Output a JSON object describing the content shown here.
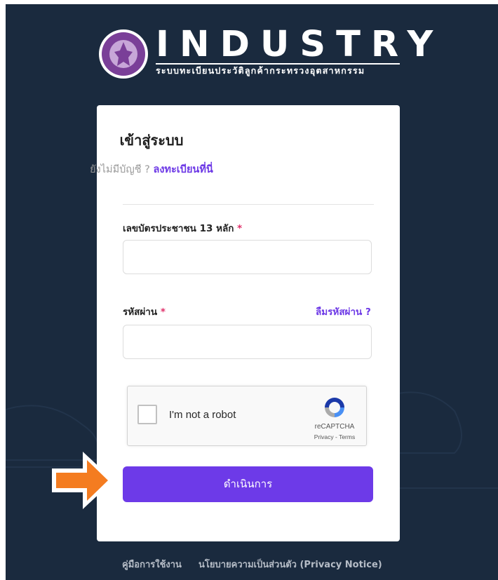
{
  "header": {
    "brand": "INDUSTRY",
    "subtitle": "ระบบทะเบียนประวัติลูกค้ากระทรวงอุตสาหกรรม",
    "seal_icon": "ministry-seal-icon"
  },
  "login": {
    "title": "เข้าสู่ระบบ",
    "signup_question": "ยังไม่มีบัญชี ?",
    "signup_link": "ลงทะเบียนที่นี่",
    "id_label": "เลขบัตรประชาชน 13 หลัก",
    "id_value": "",
    "password_label": "รหัสผ่าน",
    "password_value": "",
    "required_mark": "*",
    "forgot_password": "ลืมรหัสผ่าน ?",
    "submit_label": "ดำเนินการ"
  },
  "recaptcha": {
    "label": "I'm not a robot",
    "brand": "reCAPTCHA",
    "terms": "Privacy - Terms",
    "checked": false
  },
  "footer": {
    "manual": "คู่มือการใช้งาน",
    "privacy": "นโยบายความเป็นส่วนตัว (Privacy Notice)"
  },
  "colors": {
    "background": "#1a2a3e",
    "accent": "#6d3ae8",
    "required": "#e0306a",
    "arrow": "#f47c20"
  }
}
